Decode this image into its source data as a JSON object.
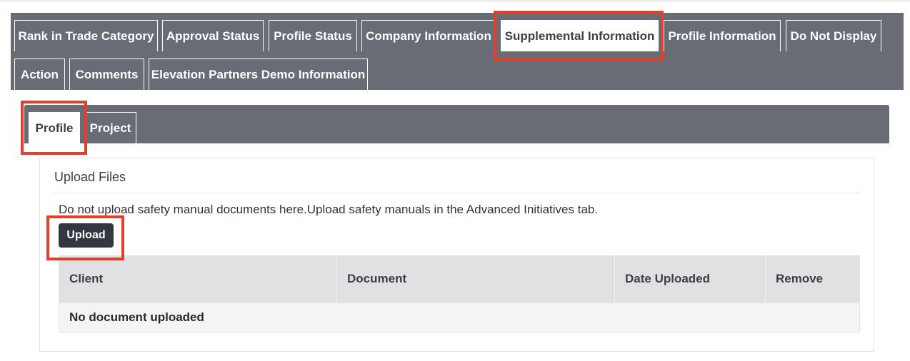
{
  "main_tabs": {
    "rank": "Rank in Trade Category",
    "approval": "Approval Status",
    "profile_status": "Profile Status",
    "company": "Company Information",
    "supplemental": "Supplemental Information",
    "profile_info": "Profile Information",
    "do_not_display": "Do Not Display",
    "action": "Action",
    "comments": "Comments",
    "elevation": "Elevation Partners Demo Information",
    "active": "Supplemental Information"
  },
  "sub_tabs": {
    "profile": "Profile",
    "project": "Project",
    "active": "Profile"
  },
  "upload": {
    "title": "Upload Files",
    "notice": "Do not upload safety manual documents here.Upload safety manuals in the Advanced Initiatives tab.",
    "button_label": "Upload"
  },
  "files_table": {
    "headers": [
      "Client",
      "Document",
      "Date Uploaded",
      "Remove"
    ],
    "empty_message": "No document uploaded"
  },
  "colors": {
    "tab_bar": "#696b75",
    "highlight": "#e2402a",
    "button": "#353740"
  }
}
